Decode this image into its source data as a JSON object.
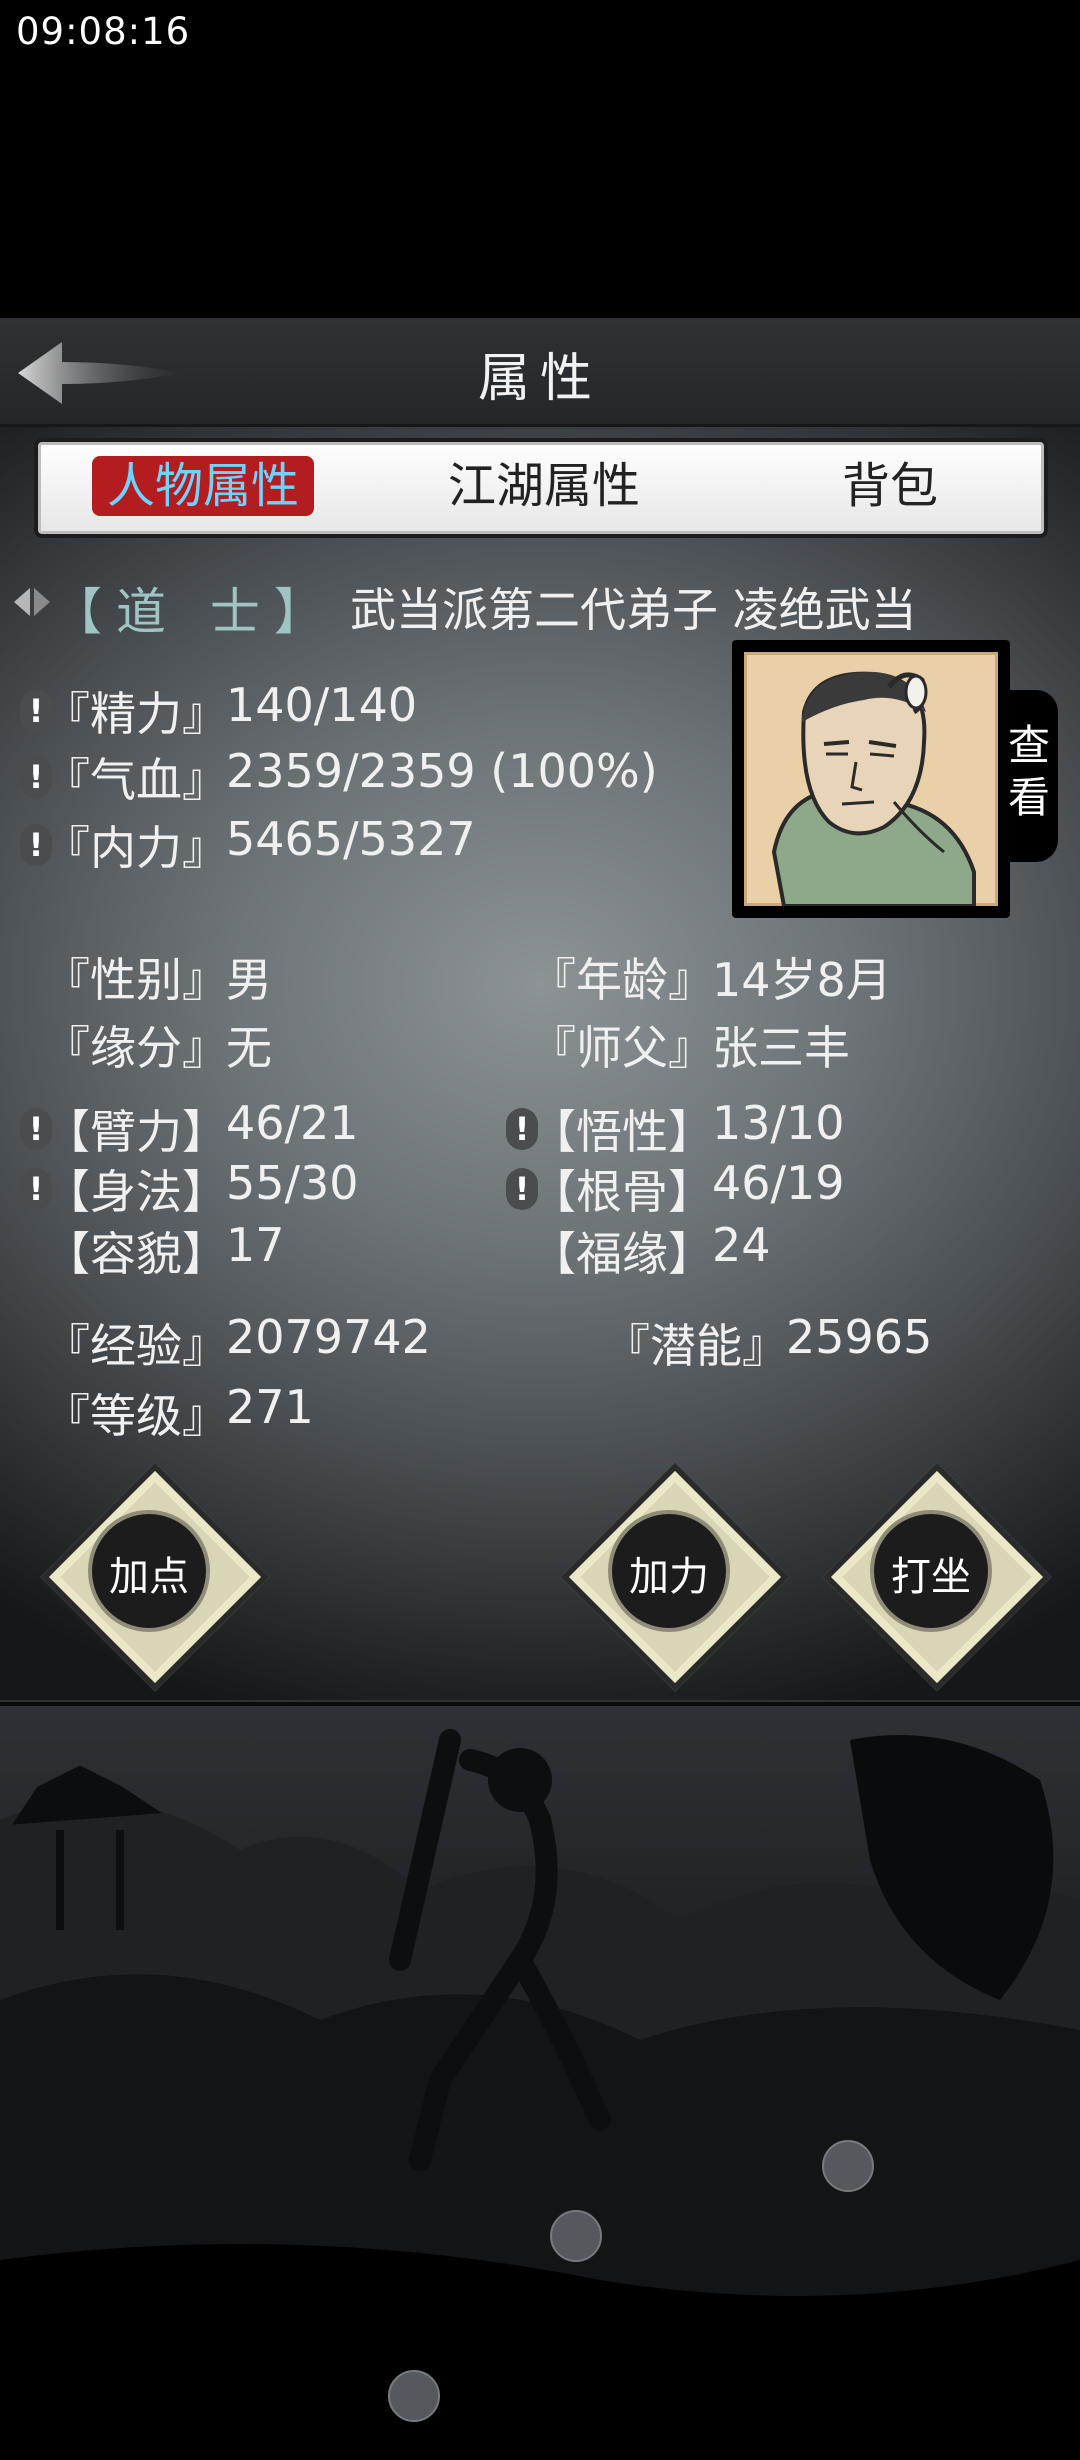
{
  "status_bar": {
    "time": "09:08:16"
  },
  "header": {
    "title": "属性"
  },
  "tabs": [
    {
      "label": "人物属性",
      "active": true
    },
    {
      "label": "江湖属性",
      "active": false
    },
    {
      "label": "背包",
      "active": false
    }
  ],
  "character": {
    "rank": "【道 士】",
    "sect": "武当派第二代弟子 凌绝武当"
  },
  "vitals": [
    {
      "label": "『精力』",
      "value": "140/140"
    },
    {
      "label": "『气血』",
      "value": "2359/2359 (100%)"
    },
    {
      "label": "『内力』",
      "value": "5465/5327"
    }
  ],
  "portrait": {
    "view_label": "查看"
  },
  "info": {
    "gender": {
      "label": "『性别』",
      "value": "男"
    },
    "age": {
      "label": "『年龄』",
      "value": "14岁8月"
    },
    "fate": {
      "label": "『缘分』",
      "value": "无"
    },
    "master": {
      "label": "『师父』",
      "value": "张三丰"
    }
  },
  "attributes": {
    "strength": {
      "label": "【臂力】",
      "value": "46/21"
    },
    "comprehension": {
      "label": "【悟性】",
      "value": "13/10"
    },
    "agility": {
      "label": "【身法】",
      "value": "55/30"
    },
    "constitution": {
      "label": "【根骨】",
      "value": "46/19"
    },
    "appearance": {
      "label": "【容貌】",
      "value": "17"
    },
    "luck": {
      "label": "【福缘】",
      "value": "24"
    }
  },
  "progress": {
    "experience": {
      "label": "『经验』",
      "value": "2079742"
    },
    "potential": {
      "label": "『潜能』",
      "value": "25965"
    },
    "level": {
      "label": "『等级』",
      "value": "271"
    }
  },
  "actions": {
    "add_points": "加点",
    "add_force": "加力",
    "meditate": "打坐"
  },
  "colors": {
    "active_tab_bg": "#b31d1f",
    "active_tab_text": "#6fd3ff",
    "rank_text": "#9ec4c4"
  }
}
